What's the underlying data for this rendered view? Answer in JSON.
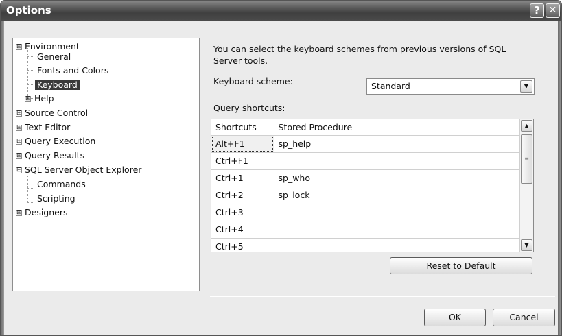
{
  "window": {
    "title": "Options",
    "help_glyph": "?",
    "close_glyph": "✕"
  },
  "tree": {
    "items": [
      {
        "label": "Environment",
        "expander": "⊟"
      },
      {
        "label": "General"
      },
      {
        "label": "Fonts and Colors"
      },
      {
        "label": "Keyboard",
        "selected": true
      },
      {
        "label": "Help",
        "expander": "⊞"
      },
      {
        "label": "Source Control",
        "expander": "⊞"
      },
      {
        "label": "Text Editor",
        "expander": "⊞"
      },
      {
        "label": "Query Execution",
        "expander": "⊞"
      },
      {
        "label": "Query Results",
        "expander": "⊞"
      },
      {
        "label": "SQL Server Object Explorer",
        "expander": "⊟"
      },
      {
        "label": "Commands"
      },
      {
        "label": "Scripting"
      },
      {
        "label": "Designers",
        "expander": "⊞"
      }
    ]
  },
  "panel": {
    "description": "You can select the keyboard schemes from previous versions of SQL Server tools.",
    "scheme_label": "Keyboard scheme:",
    "scheme_value": "Standard",
    "shortcuts_label": "Query shortcuts:",
    "columns": [
      "Shortcuts",
      "Stored Procedure"
    ],
    "rows": [
      [
        "Alt+F1",
        "sp_help"
      ],
      [
        "Ctrl+F1",
        ""
      ],
      [
        "Ctrl+1",
        "sp_who"
      ],
      [
        "Ctrl+2",
        "sp_lock"
      ],
      [
        "Ctrl+3",
        ""
      ],
      [
        "Ctrl+4",
        ""
      ],
      [
        "Ctrl+5",
        ""
      ]
    ],
    "reset_label": "Reset to Default"
  },
  "footer": {
    "ok_label": "OK",
    "cancel_label": "Cancel"
  }
}
